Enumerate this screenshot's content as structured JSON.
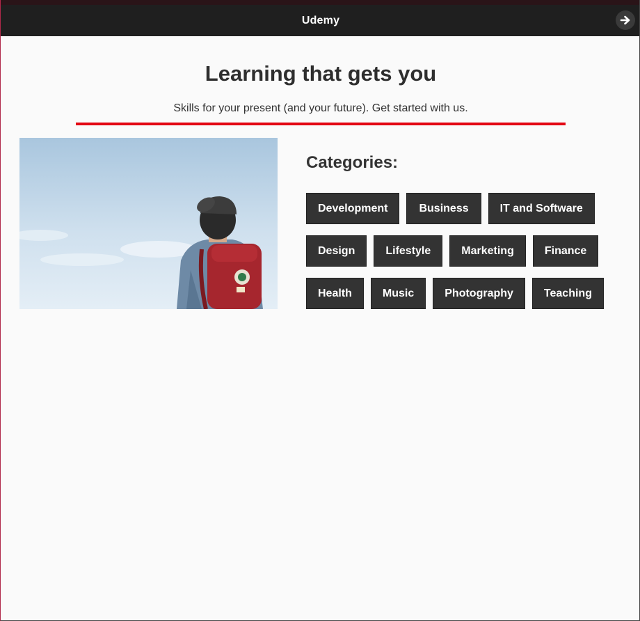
{
  "app": {
    "title": "Udemy",
    "exit_icon": "arrow-right-circle-icon"
  },
  "hero": {
    "headline": "Learning that gets you",
    "tagline": "Skills for your present (and your future). Get started with us.",
    "accent_color": "#e30613"
  },
  "categories": {
    "heading": "Categories:",
    "items": [
      "Development",
      "Business",
      "IT and Software",
      "Design",
      "Lifestyle",
      "Marketing",
      "Finance",
      "Health",
      "Music",
      "Photography",
      "Teaching"
    ]
  },
  "colors": {
    "titlebar": "#1f1f1f",
    "button_bg": "#333333",
    "page_bg": "#fafafa"
  }
}
